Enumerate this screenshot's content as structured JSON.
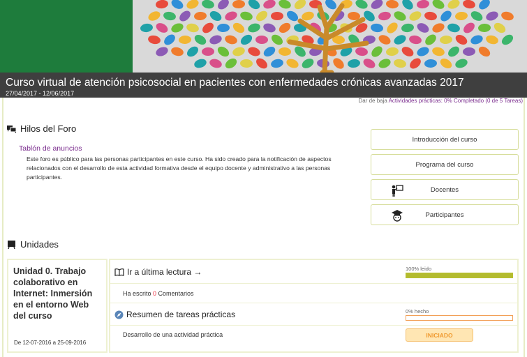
{
  "course": {
    "title": "Curso virtual de atención psicosocial en pacientes con enfermedades crónicas avanzadas 2017",
    "dates": "27/04/2017 - 12/06/2017"
  },
  "top_links": {
    "unsubscribe": "Dar de baja",
    "activities_progress": "Actividades prácticas: 0% Completado (0 de 5 Tareas)"
  },
  "forum": {
    "section_title": "Hilos del Foro",
    "board_link": "Tablón de anuncios",
    "board_description": "Este foro es público para las personas participantes en este curso. Ha sido creado para la notificación de aspectos relacionados con el desarrollo de esta actividad formativa desde el equipo docente y administrativo a las personas participantes."
  },
  "side_buttons": {
    "intro": "Introducción del curso",
    "program": "Programa del curso",
    "teachers": "Docentes",
    "participants": "Participantes"
  },
  "units": {
    "section_title": "Unidades",
    "unit0": {
      "title": "Unidad 0. Trabajo colaborativo en Internet: Inmersión en el entorno Web del curso",
      "dates": "De 12-07-2016 a 25-09-2016",
      "last_reading_label": "Ir a última lectura →",
      "read_progress_label": "100% leido",
      "read_progress_value": 100,
      "comments_prefix": "Ha escrito ",
      "comments_count": "0",
      "comments_suffix": " Comentarios",
      "tasks_summary_label": "Resumen de tareas prácticas",
      "done_progress_label": "0% hecho",
      "done_progress_value": 0,
      "activity_label": "Desarrollo de una actividad práctica",
      "activity_status": "INICIADO"
    }
  },
  "colors": {
    "accent_purple": "#7b2d8e",
    "progress_green": "#b3bb2f",
    "status_orange": "#f09a30",
    "banner_green": "#1e7c3c"
  }
}
